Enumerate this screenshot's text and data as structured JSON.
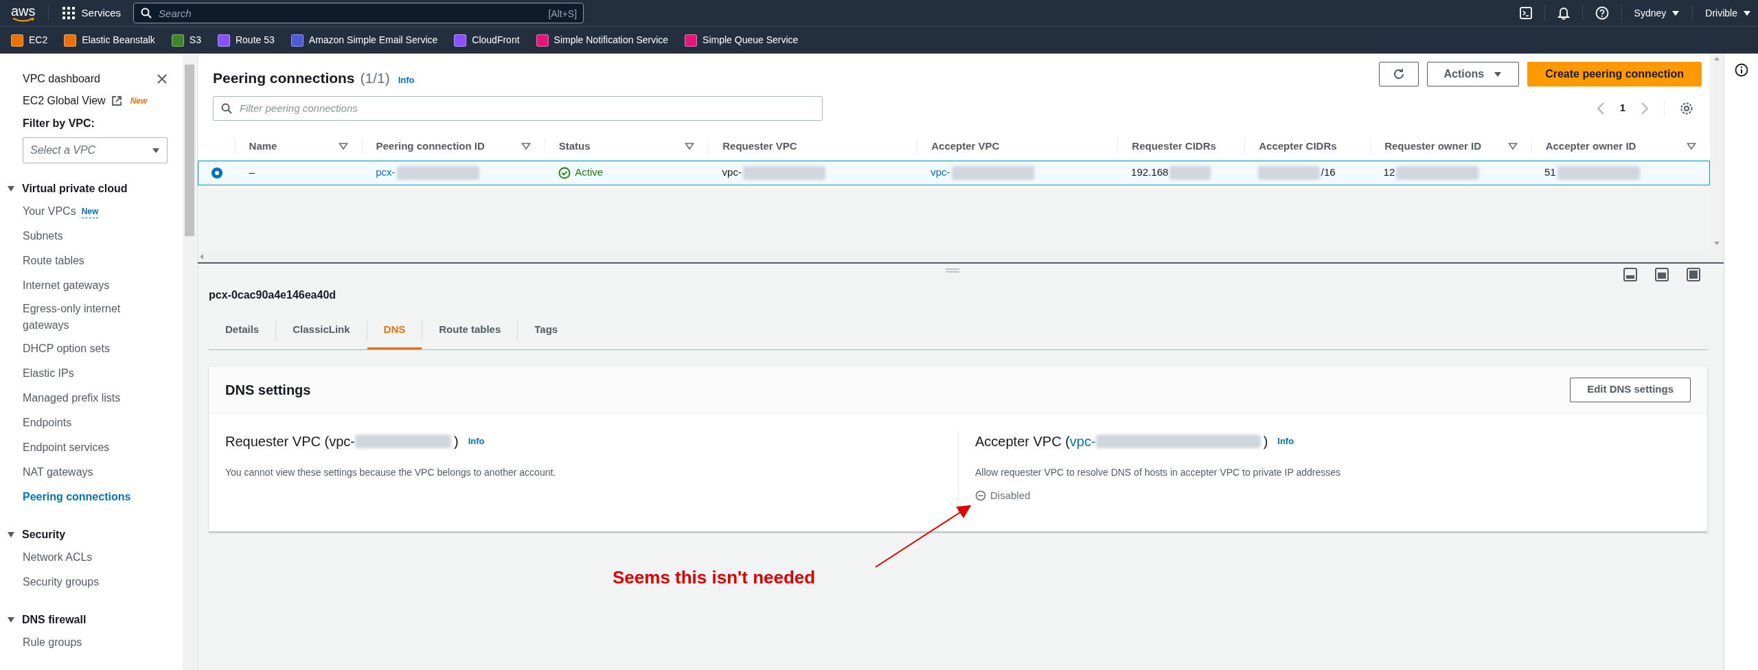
{
  "top_bar": {
    "logo": "aws",
    "services": "Services",
    "search": {
      "placeholder": "Search",
      "shortcut": "[Alt+S]"
    },
    "region": "Sydney",
    "account": "Drivible"
  },
  "favorites": [
    {
      "label": "EC2",
      "color": "#ed7100"
    },
    {
      "label": "Elastic Beanstalk",
      "color": "#ed7100"
    },
    {
      "label": "S3",
      "color": "#3f8624"
    },
    {
      "label": "Route 53",
      "color": "#8c4fff"
    },
    {
      "label": "Amazon Simple Email Service",
      "color": "#4d5bd9"
    },
    {
      "label": "CloudFront",
      "color": "#8c4fff"
    },
    {
      "label": "Simple Notification Service",
      "color": "#e7157b"
    },
    {
      "label": "Simple Queue Service",
      "color": "#e7157b"
    }
  ],
  "sidebar": {
    "dashboard": "VPC dashboard",
    "global_view": {
      "label": "EC2 Global View",
      "badge": "New"
    },
    "filter_label": "Filter by VPC:",
    "filter_placeholder": "Select a VPC",
    "sections": [
      {
        "title": "Virtual private cloud",
        "expanded": true,
        "items": [
          {
            "label": "Your VPCs",
            "badge": "New",
            "selected": false
          },
          {
            "label": "Subnets",
            "selected": false
          },
          {
            "label": "Route tables",
            "selected": false
          },
          {
            "label": "Internet gateways",
            "selected": false
          },
          {
            "label": "Egress-only internet gateways",
            "selected": false
          },
          {
            "label": "DHCP option sets",
            "selected": false
          },
          {
            "label": "Elastic IPs",
            "selected": false
          },
          {
            "label": "Managed prefix lists",
            "selected": false
          },
          {
            "label": "Endpoints",
            "selected": false
          },
          {
            "label": "Endpoint services",
            "selected": false
          },
          {
            "label": "NAT gateways",
            "selected": false
          },
          {
            "label": "Peering connections",
            "selected": true
          }
        ]
      },
      {
        "title": "Security",
        "expanded": true,
        "items": [
          {
            "label": "Network ACLs",
            "selected": false
          },
          {
            "label": "Security groups",
            "selected": false
          }
        ]
      },
      {
        "title": "DNS firewall",
        "expanded": true,
        "items": [
          {
            "label": "Rule groups",
            "selected": false
          }
        ]
      }
    ]
  },
  "table": {
    "title": "Peering connections",
    "count": "(1/1)",
    "info": "Info",
    "actions": "Actions",
    "create": "Create peering connection",
    "filter_placeholder": "Filter peering connections",
    "page": "1",
    "columns": [
      {
        "label": "Name",
        "sortable": true
      },
      {
        "label": "Peering connection ID",
        "sortable": true
      },
      {
        "label": "Status",
        "sortable": true
      },
      {
        "label": "Requester VPC",
        "sortable": false
      },
      {
        "label": "Accepter VPC",
        "sortable": false
      },
      {
        "label": "Requester CIDRs",
        "sortable": false
      },
      {
        "label": "Accepter CIDRs",
        "sortable": false
      },
      {
        "label": "Requester owner ID",
        "sortable": true
      },
      {
        "label": "Accepter owner ID",
        "sortable": true
      }
    ],
    "rows": [
      {
        "selected": true,
        "cells": [
          {
            "kind": "text",
            "text": "–"
          },
          {
            "kind": "link",
            "text": "pcx-",
            "redacted_after": true
          },
          {
            "kind": "status",
            "text": "Active"
          },
          {
            "kind": "text",
            "text": "vpc-",
            "redacted_after": true
          },
          {
            "kind": "link",
            "text": "vpc-",
            "redacted_after": true
          },
          {
            "kind": "text",
            "text": "192.168",
            "redacted_after": true
          },
          {
            "kind": "text",
            "text": "/16",
            "redacted_before": true
          },
          {
            "kind": "text",
            "text": "12",
            "redacted_after": true
          },
          {
            "kind": "text",
            "text": "51",
            "redacted_after": true
          }
        ]
      }
    ]
  },
  "details": {
    "title": "pcx-0cac90a4e146ea40d",
    "tabs": [
      {
        "label": "Details",
        "selected": false
      },
      {
        "label": "ClassicLink",
        "selected": false
      },
      {
        "label": "DNS",
        "selected": true
      },
      {
        "label": "Route tables",
        "selected": false
      },
      {
        "label": "Tags",
        "selected": false
      }
    ],
    "card": {
      "title": "DNS settings",
      "edit": "Edit DNS settings",
      "columns": [
        {
          "prefix": "Requester VPC (",
          "vpc": "vpc-",
          "vpc_link": false,
          "suffix": ")",
          "info": "Info",
          "description": "You cannot view these settings because the VPC belongs to another account."
        },
        {
          "prefix": "Accepter VPC (",
          "vpc": "vpc-",
          "vpc_link": true,
          "suffix": ")",
          "info": "Info",
          "description": "Allow requester VPC to resolve DNS of hosts in accepter VPC to private IP addresses",
          "status": "Disabled"
        }
      ]
    }
  },
  "annotation": {
    "text": "Seems this isn't needed"
  }
}
